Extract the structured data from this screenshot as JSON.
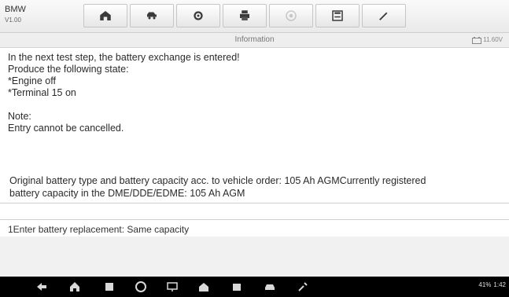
{
  "app": {
    "brand": "BMW",
    "version": "V1.00"
  },
  "toolbar": {
    "buttons": [
      {
        "icon": "home-icon"
      },
      {
        "icon": "vehicle-swap-icon"
      },
      {
        "icon": "settings-icon"
      },
      {
        "icon": "print-icon"
      },
      {
        "icon": "help-icon"
      },
      {
        "icon": "save-icon"
      },
      {
        "icon": "edit-icon"
      }
    ]
  },
  "infobar": {
    "title": "Information",
    "voltage": "11.60V"
  },
  "content": {
    "lines": [
      "In the next test step, the battery exchange is entered!",
      "Produce the following state:",
      " *Engine off",
      " *Terminal 15 on",
      "",
      " Note:",
      "Entry cannot be cancelled."
    ],
    "battery_info": [
      "Original battery type and battery capacity acc. to vehicle order: 105 Ah AGMCurrently registered",
      "battery capacity in the DME/DDE/EDME: 105 Ah AGM"
    ]
  },
  "option": {
    "label": "1Enter battery replacement: Same capacity"
  },
  "navbar": {
    "icons": [
      "back-icon",
      "home-icon",
      "recent-apps-icon",
      "browser-icon",
      "remote-icon",
      "autel-home-icon",
      "gallery-icon",
      "vehicle-icon",
      "tools-icon"
    ],
    "status": {
      "battery": "41%",
      "time": "1:42"
    }
  }
}
